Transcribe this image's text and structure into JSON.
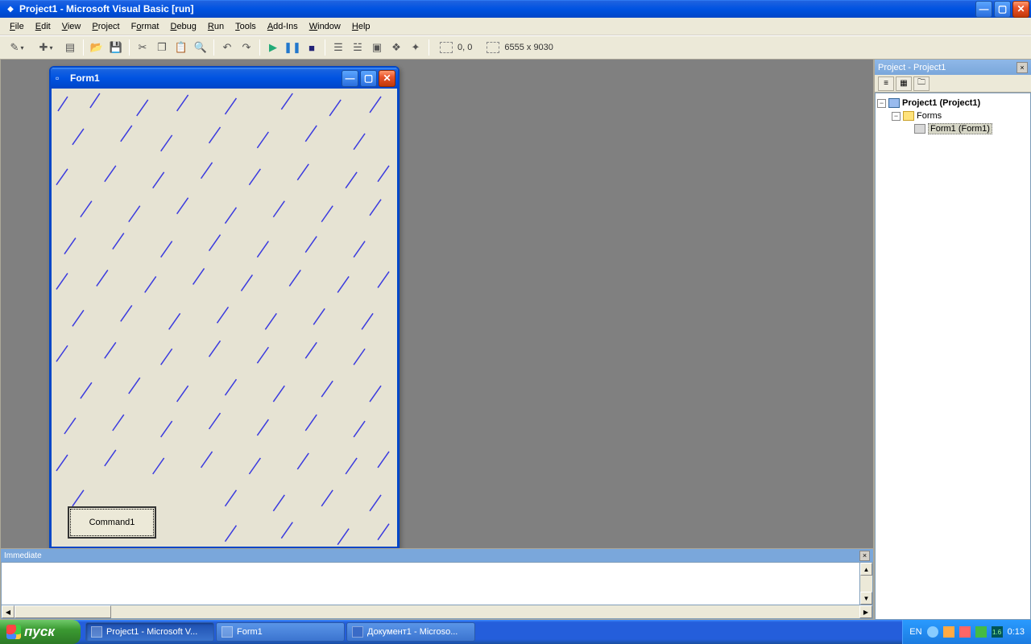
{
  "window": {
    "title": "Project1 - Microsoft Visual Basic [run]"
  },
  "menubar": {
    "file": "File",
    "edit": "Edit",
    "view": "View",
    "project": "Project",
    "format": "Format",
    "debug": "Debug",
    "run": "Run",
    "tools": "Tools",
    "addins": "Add-Ins",
    "window": "Window",
    "help": "Help"
  },
  "toolbar": {
    "coords": "0, 0",
    "size": "6555 x 9030"
  },
  "mdi_form": {
    "title": "Form1",
    "command1": "Command1"
  },
  "project_panel": {
    "title": "Project - Project1",
    "root": "Project1 (Project1)",
    "forms_folder": "Forms",
    "form_item": "Form1 (Form1)"
  },
  "immediate": {
    "title": "Immediate"
  },
  "taskbar": {
    "start": "пуск",
    "task_vb": "Project1 - Microsoft V...",
    "task_form": "Form1",
    "task_word": "Документ1 - Microso...",
    "lang": "EN",
    "clock": "0:13"
  }
}
